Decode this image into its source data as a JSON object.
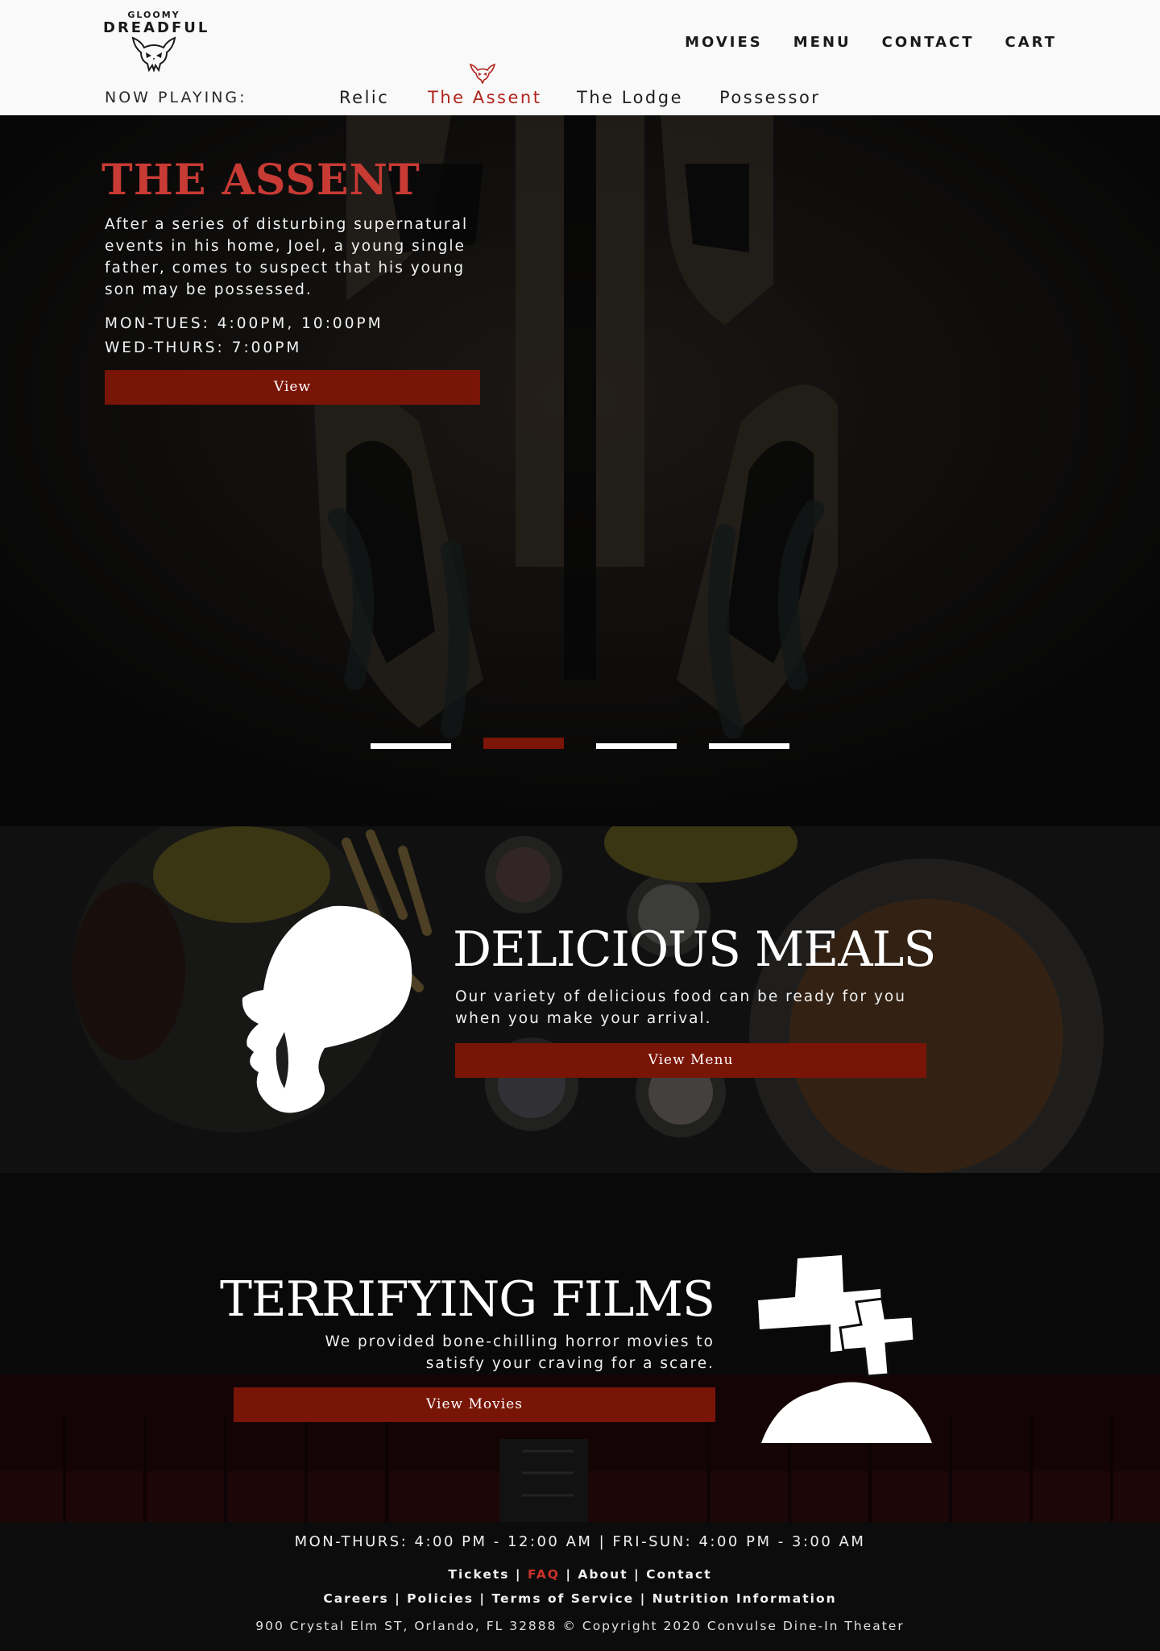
{
  "brand": {
    "top": "GLOOMY",
    "main": "DREADFUL"
  },
  "nav": {
    "items": [
      "MOVIES",
      "MENU",
      "CONTACT",
      "CART"
    ]
  },
  "now_playing": {
    "label": "NOW PLAYING:",
    "movies": [
      "Relic",
      "The Assent",
      "The Lodge",
      "Possessor"
    ],
    "active": "The Assent"
  },
  "hero": {
    "title": "THE ASSENT",
    "description": "After a series of disturbing supernatural events in his home, Joel, a young single father, comes to suspect that his young son may be possessed.",
    "schedule": [
      "MON-TUES: 4:00PM, 10:00PM",
      "WED-THURS: 7:00PM"
    ],
    "button": "View",
    "slides": 4,
    "active_slide": 2
  },
  "meals": {
    "title": "DELICIOUS MEALS",
    "description": "Our variety of delicious food can be ready for you when you make your arrival.",
    "button": "View Menu"
  },
  "films": {
    "title": "TERRIFYING FILMS",
    "description": "We provided bone-chilling horror movies to satisfy your craving for a scare.",
    "button": "View Movies"
  },
  "footer": {
    "hours": "MON-THURS: 4:00 PM - 12:00 AM | FRI-SUN: 4:00 PM - 3:00 AM",
    "links_row1": [
      "Tickets",
      "FAQ",
      "About",
      "Contact"
    ],
    "links_row2": [
      "Careers",
      "Policies",
      "Terms of Service",
      "Nutrition Information"
    ],
    "copyright": "900 Crystal Elm ST, Orlando, FL 32888 © Copyright 2020 Convulse Dine-In Theater"
  },
  "colors": {
    "accent": "#791507",
    "active_tab": "#b0231a",
    "hero_title": "#c83a34",
    "header_bg": "#f9f9f9",
    "page_bg": "#0c0c0c"
  },
  "icons": [
    "skull-logo-icon",
    "bat-icon",
    "screaming-head-icon",
    "grave-cross-icon"
  ]
}
